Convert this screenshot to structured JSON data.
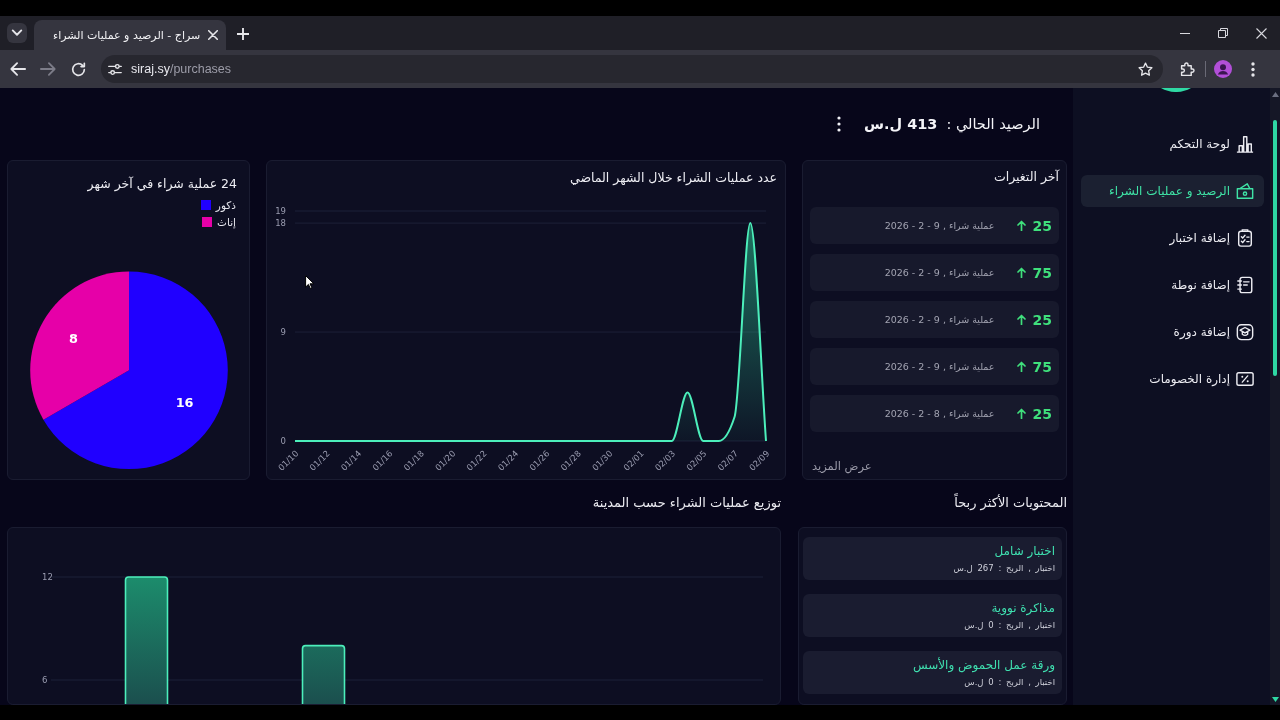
{
  "browser": {
    "tabs": [
      {
        "title": "سراج - الرصيد و عمليات الشراء",
        "selected": true
      }
    ],
    "nav_buttons": [
      {
        "kind": "back",
        "disabled": false
      },
      {
        "kind": "forward",
        "disabled": true
      },
      {
        "kind": "reload",
        "disabled": false
      }
    ],
    "address": {
      "host": "siraj.sy",
      "path": "/purchases"
    }
  },
  "sidebar": {
    "items": [
      {
        "label": "لوحة التحكم",
        "selected": false
      },
      {
        "label": "الرصيد و عمليات الشراء",
        "selected": true
      },
      {
        "label": "إضافة اختبار",
        "selected": false
      },
      {
        "label": "إضافة نوطة",
        "selected": false
      },
      {
        "label": "إضافة دورة",
        "selected": false
      },
      {
        "label": "إدارة الخصومات",
        "selected": false
      }
    ]
  },
  "balance": {
    "label": "الرصيد الحالي :",
    "value": "413 ل.س"
  },
  "recent_changes": {
    "title": "آخر التغيرات",
    "items": [
      {
        "amount": "25",
        "description": "عملية شراء , 9 - 2 - 2026"
      },
      {
        "amount": "75",
        "description": "عملية شراء , 9 - 2 - 2026"
      },
      {
        "amount": "25",
        "description": "عملية شراء , 9 - 2 - 2026"
      },
      {
        "amount": "75",
        "description": "عملية شراء , 9 - 2 - 2026"
      },
      {
        "amount": "25",
        "description": "عملية شراء , 8 - 2 - 2026"
      }
    ],
    "more_link": "عرض المزيد"
  },
  "purchases_chart": {
    "chart_data": {
      "type": "area",
      "title": "عدد عمليات الشراء خلال الشهر الماضي",
      "categories": [
        "01/10",
        null,
        "01/12",
        null,
        "01/14",
        null,
        "01/16",
        null,
        "01/18",
        null,
        "01/20",
        null,
        "01/22",
        null,
        "01/24",
        null,
        "01/26",
        null,
        "01/28",
        null,
        "01/30",
        null,
        "02/01",
        null,
        "02/03",
        null,
        "02/05",
        null,
        "02/07",
        null,
        "02/09"
      ],
      "values": [
        0,
        0,
        0,
        0,
        0,
        0,
        0,
        0,
        0,
        0,
        0,
        0,
        0,
        0,
        0,
        0,
        0,
        0,
        0,
        0,
        0,
        0,
        0,
        0,
        0,
        4,
        0,
        0,
        2,
        18,
        0
      ],
      "ylim": [
        0,
        19
      ],
      "yticks": [
        0,
        9,
        18,
        19
      ]
    }
  },
  "gender_chart": {
    "chart_data": {
      "type": "pie",
      "title": "24 عملية شراء في آخر شهر",
      "categories": [
        "ذكور",
        "إناث"
      ],
      "values": [
        16,
        8
      ],
      "colors": [
        "#2000ff",
        "#e600a8"
      ],
      "data_labels": true
    }
  },
  "top_content": {
    "title": "المحتويات الأكثر ربحاً",
    "items": [
      {
        "title": "اختبار شامل",
        "meta": "اختبار , الربح : 267 ل.س"
      },
      {
        "title": "مذاكرة نووية",
        "meta": "اختبار , الربح : 0 ل.س"
      },
      {
        "title": "ورقة عمل الحموض والأسس",
        "meta": "اختبار , الربح : 0 ل.س"
      }
    ]
  },
  "city_chart": {
    "chart_data": {
      "type": "bar",
      "title": "توزيع عمليات الشراء حسب المدينة",
      "values": [
        12,
        8,
        null,
        null
      ],
      "ylim": [
        0,
        12
      ],
      "yticks": [
        6,
        12
      ]
    }
  }
}
